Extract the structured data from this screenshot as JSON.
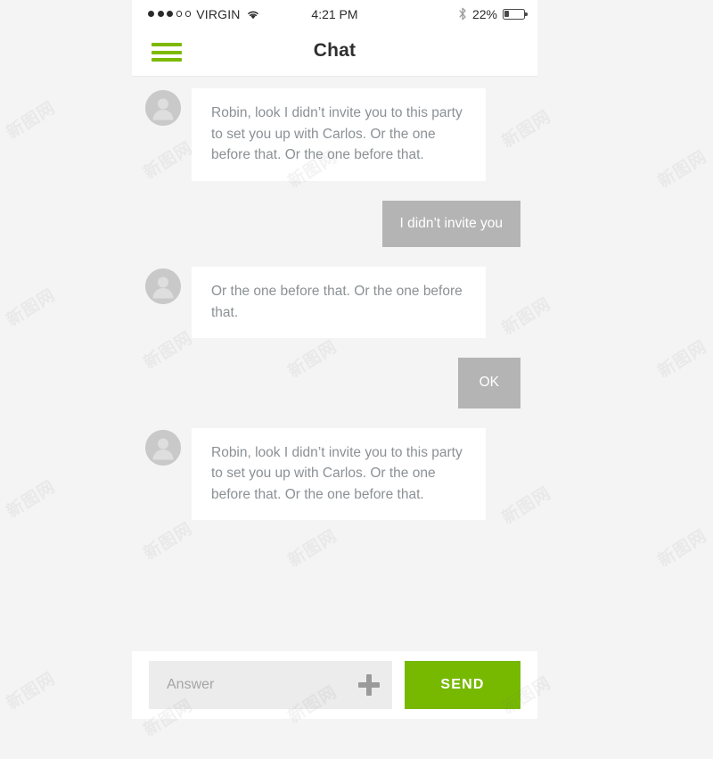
{
  "status_bar": {
    "signal_dots_filled": 3,
    "signal_dots_total": 5,
    "carrier": "VIRGIN",
    "wifi_icon": "wifi-icon",
    "time": "4:21 PM",
    "bluetooth_icon": "bluetooth-icon",
    "battery_percent": "22%",
    "battery_level": 22
  },
  "navbar": {
    "menu_icon": "hamburger-menu-icon",
    "title": "Chat",
    "accent_color": "#7cb900"
  },
  "conversation": {
    "avatar_icon": "user-avatar-icon",
    "messages": [
      {
        "direction": "in",
        "text": "Robin, look I didn’t invite you to this party to set you up with Carlos. Or the one before that. Or the one before that."
      },
      {
        "direction": "out",
        "text": "I didn’t invite you"
      },
      {
        "direction": "in",
        "text": "Or the one before that. Or the one before that."
      },
      {
        "direction": "out",
        "text": "OK"
      },
      {
        "direction": "in",
        "text": "Robin, look I didn’t invite you to this party to set you up with Carlos. Or the one before that. Or the one before that."
      }
    ]
  },
  "composer": {
    "input_value": "",
    "input_placeholder": "Answer",
    "attach_icon": "plus-icon",
    "send_label": "SEND",
    "send_color": "#76b900"
  },
  "watermark": {
    "text": "新图网"
  },
  "colors": {
    "page_background": "#f4f4f4",
    "panel": "#ffffff",
    "incoming_bubble": "#ffffff",
    "outgoing_bubble": "#b4b4b4",
    "incoming_text": "#8b9195",
    "outgoing_text": "#ffffff",
    "input_field": "#ececec"
  }
}
